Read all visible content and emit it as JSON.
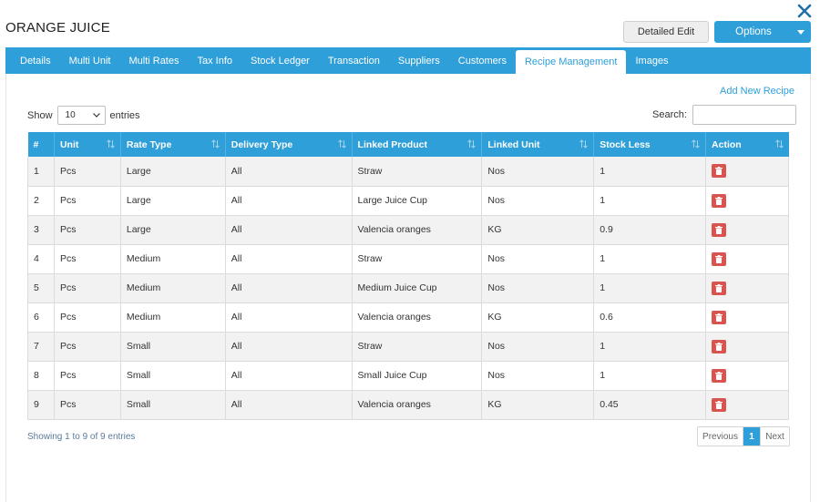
{
  "header": {
    "title": "ORANGE JUICE",
    "detailed_edit_label": "Detailed Edit",
    "options_label": "Options"
  },
  "tabs": [
    {
      "label": "Details",
      "active": false
    },
    {
      "label": "Multi Unit",
      "active": false
    },
    {
      "label": "Multi Rates",
      "active": false
    },
    {
      "label": "Tax Info",
      "active": false
    },
    {
      "label": "Stock Ledger",
      "active": false
    },
    {
      "label": "Transaction",
      "active": false
    },
    {
      "label": "Suppliers",
      "active": false
    },
    {
      "label": "Customers",
      "active": false
    },
    {
      "label": "Recipe Management",
      "active": true
    },
    {
      "label": "Images",
      "active": false
    }
  ],
  "panel": {
    "add_recipe_label": "Add New Recipe",
    "show_label": "Show",
    "entries_value": "10",
    "entries_label": "entries",
    "search_label": "Search:"
  },
  "table": {
    "columns": [
      "#",
      "Unit",
      "Rate Type",
      "Delivery Type",
      "Linked Product",
      "Linked Unit",
      "Stock Less",
      "Action"
    ],
    "rows": [
      [
        "1",
        "Pcs",
        "Large",
        "All",
        "Straw",
        "Nos",
        "1"
      ],
      [
        "2",
        "Pcs",
        "Large",
        "All",
        "Large Juice Cup",
        "Nos",
        "1"
      ],
      [
        "3",
        "Pcs",
        "Large",
        "All",
        "Valencia oranges",
        "KG",
        "0.9"
      ],
      [
        "4",
        "Pcs",
        "Medium",
        "All",
        "Straw",
        "Nos",
        "1"
      ],
      [
        "5",
        "Pcs",
        "Medium",
        "All",
        "Medium Juice Cup",
        "Nos",
        "1"
      ],
      [
        "6",
        "Pcs",
        "Medium",
        "All",
        "Valencia oranges",
        "KG",
        "0.6"
      ],
      [
        "7",
        "Pcs",
        "Small",
        "All",
        "Straw",
        "Nos",
        "1"
      ],
      [
        "8",
        "Pcs",
        "Small",
        "All",
        "Small Juice Cup",
        "Nos",
        "1"
      ],
      [
        "9",
        "Pcs",
        "Small",
        "All",
        "Valencia oranges",
        "KG",
        "0.45"
      ]
    ]
  },
  "footer": {
    "info": "Showing 1 to 9 of 9 entries",
    "prev_label": "Previous",
    "page": "1",
    "next_label": "Next"
  },
  "colors": {
    "accent": "#2e9fd8",
    "danger": "#d9534f"
  },
  "icons": {
    "close": "close-icon",
    "options_caret": "caret-down-icon",
    "sort": "sort-icon",
    "delete": "trash-icon"
  }
}
